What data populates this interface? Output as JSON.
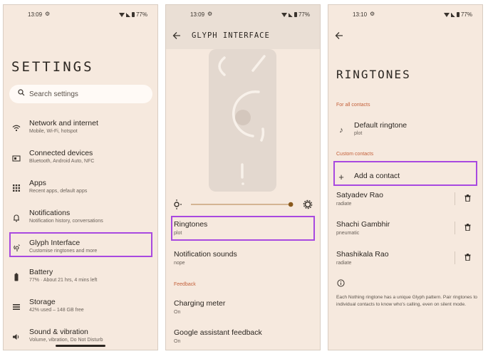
{
  "screens": [
    {
      "status": {
        "time": "13:09",
        "battery": "77%"
      },
      "title": "SETTINGS",
      "search": {
        "placeholder": "Search settings"
      },
      "items": [
        {
          "icon": "wifi-icon",
          "title": "Network and internet",
          "subtitle": "Mobile, Wi-Fi, hotspot"
        },
        {
          "icon": "devices-icon",
          "title": "Connected devices",
          "subtitle": "Bluetooth, Android Auto, NFC"
        },
        {
          "icon": "apps-icon",
          "title": "Apps",
          "subtitle": "Recent apps, default apps"
        },
        {
          "icon": "bell-icon",
          "title": "Notifications",
          "subtitle": "Notification history, conversations"
        },
        {
          "icon": "glyph-icon",
          "title": "Glyph Interface",
          "subtitle": "Customise ringtones and more",
          "highlighted": true
        },
        {
          "icon": "battery-icon",
          "title": "Battery",
          "subtitle": "77% · About 21 hrs, 4 mins left"
        },
        {
          "icon": "storage-icon",
          "title": "Storage",
          "subtitle": "42% used – 148 GB free"
        },
        {
          "icon": "volume-icon",
          "title": "Sound & vibration",
          "subtitle": "Volume, vibration, Do Not Disturb"
        }
      ]
    },
    {
      "status": {
        "time": "13:09",
        "battery": "77%"
      },
      "title": "GLYPH INTERFACE",
      "brightness": 0.96,
      "items": [
        {
          "title": "Ringtones",
          "subtitle": "plot",
          "highlighted": true
        },
        {
          "title": "Notification sounds",
          "subtitle": "nope"
        }
      ],
      "feedback_section": "Feedback",
      "feedback_items": [
        {
          "title": "Charging meter",
          "subtitle": "On"
        },
        {
          "title": "Google assistant feedback",
          "subtitle": "On"
        }
      ]
    },
    {
      "status": {
        "time": "13:10",
        "battery": "77%"
      },
      "title": "RINGTONES",
      "for_all_section": "For all contacts",
      "default": {
        "title": "Default ringtone",
        "subtitle": "plot"
      },
      "custom_section": "Custom contacts",
      "add_contact": "Add a contact",
      "contacts": [
        {
          "name": "Satyadev Rao",
          "tone": "radiate"
        },
        {
          "name": "Shachi Gambhir",
          "tone": "pneumatic"
        },
        {
          "name": "Shashikala Rao",
          "tone": "radiate"
        }
      ],
      "note": "Each Nothing ringtone has a unique Glyph pattern. Pair ringtones to individual contacts to know who's calling, even on silent mode."
    }
  ],
  "colors": {
    "background": "#f6e9de",
    "highlight": "#a849e0",
    "section_accent": "#c4613b",
    "slider_accent": "#8a5a1d"
  }
}
